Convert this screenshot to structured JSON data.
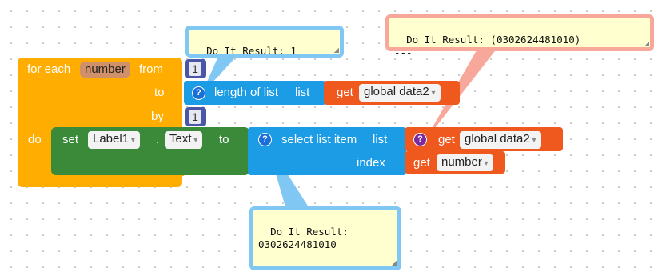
{
  "colors": {
    "control": "#ffad00",
    "component_set": "#3a8a3a",
    "list": "#1b9ce4",
    "variable": "#f0591e",
    "math": "#4a56a6",
    "comment_blue": "#80c8f3",
    "comment_red": "#f7a89a"
  },
  "for_each": {
    "label_for_each": "for each",
    "var_name": "number",
    "label_from": "from",
    "label_to": "to",
    "label_by": "by",
    "label_do": "do",
    "from_value": "1",
    "by_value": "1"
  },
  "length_block": {
    "help": "?",
    "label": "length of list",
    "list_label": "list"
  },
  "get_data2_top": {
    "label": "get",
    "var": "global data2"
  },
  "set_block": {
    "label_set": "set",
    "component": "Label1",
    "dot": ".",
    "property": "Text",
    "label_to": "to"
  },
  "select_block": {
    "help": "?",
    "label": "select list item",
    "list_label": "list",
    "index_label": "index"
  },
  "get_data2_select": {
    "help": "?",
    "label": "get",
    "var": "global data2"
  },
  "get_number": {
    "label": "get",
    "var": "number"
  },
  "bubbles": {
    "top": "Do It Result: 1",
    "right": "Do It Result: (0302624481010)\n---",
    "bottom": "Do It Result:\n0302624481010\n---"
  }
}
